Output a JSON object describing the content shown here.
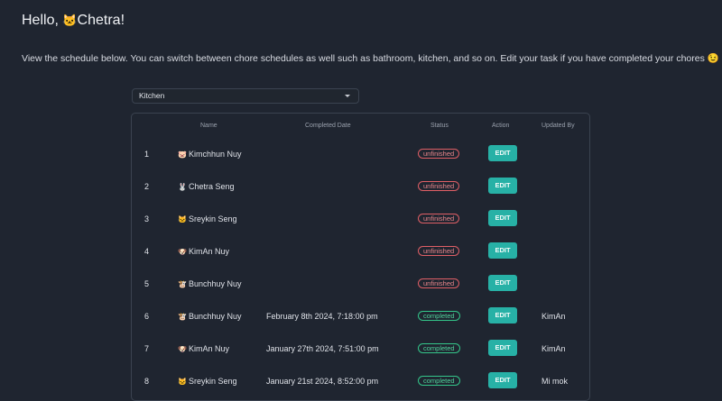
{
  "greeting": {
    "prefix": "Hello,",
    "emoji": "🐱",
    "name": "Chetra!"
  },
  "intro": {
    "text": "View the schedule below. You can switch between chore schedules as well such as bathroom, kitchen, and so on. Edit your task if you have completed your chores",
    "emoji": "😉"
  },
  "schedule_select": {
    "value": "Kitchen"
  },
  "table": {
    "headers": {
      "index": "",
      "name": "Name",
      "completed_date": "Completed Date",
      "status": "Status",
      "action": "Action",
      "updated_by": "Updated By"
    },
    "rows": [
      {
        "index": "1",
        "emoji": "🐷",
        "name": "Kimchhun Nuy",
        "completed_date": "",
        "status": "unfinished",
        "action": "EDIT",
        "updated_by": ""
      },
      {
        "index": "2",
        "emoji": "🐰",
        "name": "Chetra Seng",
        "completed_date": "",
        "status": "unfinished",
        "action": "EDIT",
        "updated_by": ""
      },
      {
        "index": "3",
        "emoji": "🐱",
        "name": "Sreykin Seng",
        "completed_date": "",
        "status": "unfinished",
        "action": "EDIT",
        "updated_by": ""
      },
      {
        "index": "4",
        "emoji": "🐶",
        "name": "KimAn Nuy",
        "completed_date": "",
        "status": "unfinished",
        "action": "EDIT",
        "updated_by": ""
      },
      {
        "index": "5",
        "emoji": "🐮",
        "name": "Bunchhuy Nuy",
        "completed_date": "",
        "status": "unfinished",
        "action": "EDIT",
        "updated_by": ""
      },
      {
        "index": "6",
        "emoji": "🐮",
        "name": "Bunchhuy Nuy",
        "completed_date": "February 8th 2024, 7:18:00 pm",
        "status": "completed",
        "action": "EDIT",
        "updated_by": "KimAn"
      },
      {
        "index": "7",
        "emoji": "🐶",
        "name": "KimAn Nuy",
        "completed_date": "January 27th 2024, 7:51:00 pm",
        "status": "completed",
        "action": "EDIT",
        "updated_by": "KimAn"
      },
      {
        "index": "8",
        "emoji": "🐱",
        "name": "Sreykin Seng",
        "completed_date": "January 21st 2024, 8:52:00 pm",
        "status": "completed",
        "action": "EDIT",
        "updated_by": "Mi mok"
      }
    ]
  },
  "colors": {
    "background": "#1f2530",
    "border": "#3b4350",
    "edit_button": "#27b1a6",
    "unfinished": "#e05f66",
    "completed": "#34c78a"
  }
}
